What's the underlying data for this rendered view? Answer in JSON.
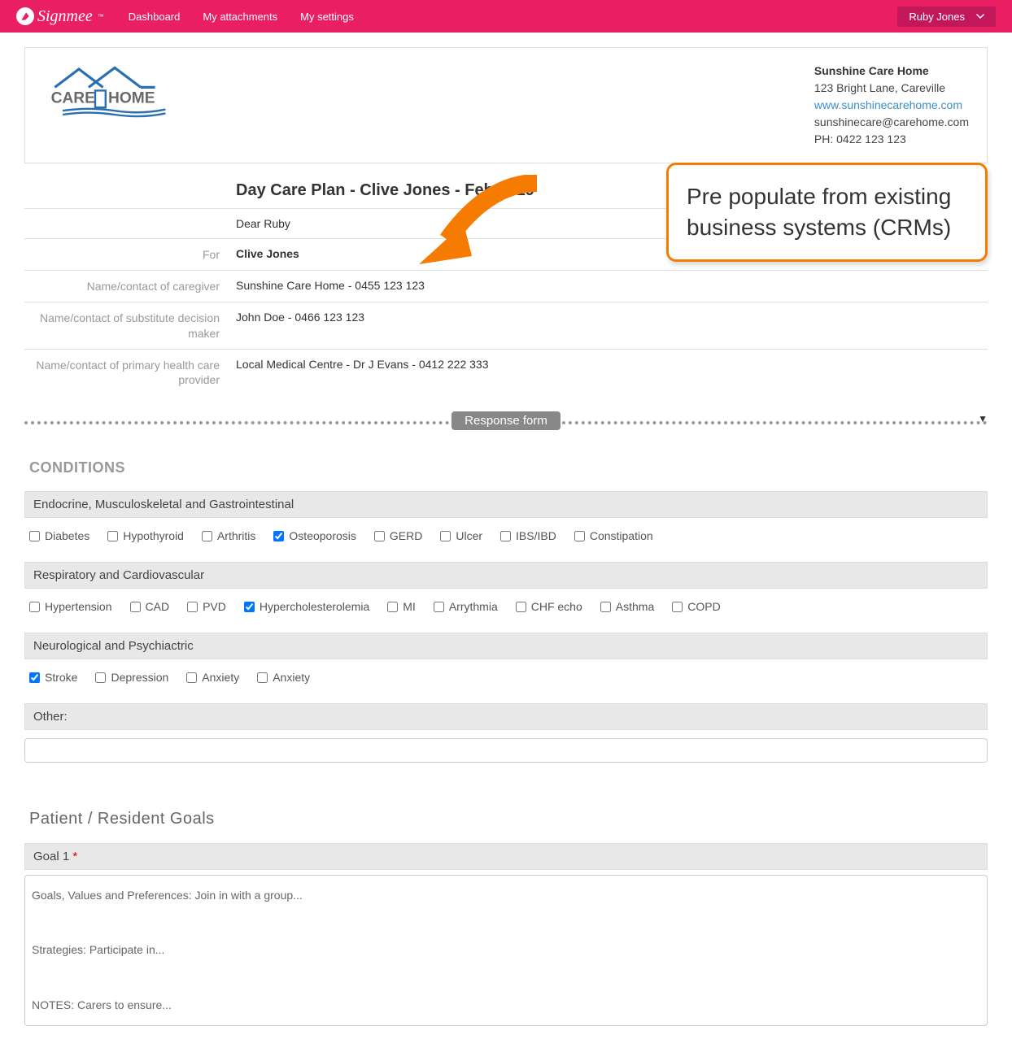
{
  "header": {
    "brand": "Signmee",
    "tm": "™",
    "nav": {
      "dashboard": "Dashboard",
      "attachments": "My attachments",
      "settings": "My settings"
    },
    "user": "Ruby Jones"
  },
  "org": {
    "logo_alt": "CARE HOME",
    "name": "Sunshine Care Home",
    "address": "123 Bright Lane, Careville",
    "website": "www.sunshinecarehome.com",
    "email": "sunshinecare@carehome.com",
    "phone": "PH: 0422 123 123"
  },
  "doc": {
    "title": "Day Care Plan - Clive Jones - Feb 2019",
    "greeting": "Dear Ruby",
    "rows": {
      "for_label": "For",
      "for_value": "Clive Jones",
      "caregiver_label": "Name/contact of caregiver",
      "caregiver_value": "Sunshine Care Home - 0455 123 123",
      "sub_label": "Name/contact of substitute decision maker",
      "sub_value": "John Doe - 0466 123 123",
      "primary_label": "Name/contact of primary health care provider",
      "primary_value": "Local Medical Centre - Dr J Evans - 0412 222 333"
    }
  },
  "divider": {
    "label": "Response form"
  },
  "conditions": {
    "heading": "CONDITIONS",
    "sections": [
      {
        "title": "Endocrine, Musculoskeletal and Gastrointestinal",
        "items": [
          {
            "label": "Diabetes",
            "checked": false
          },
          {
            "label": "Hypothyroid",
            "checked": false
          },
          {
            "label": "Arthritis",
            "checked": false
          },
          {
            "label": "Osteoporosis",
            "checked": true
          },
          {
            "label": "GERD",
            "checked": false
          },
          {
            "label": "Ulcer",
            "checked": false
          },
          {
            "label": "IBS/IBD",
            "checked": false
          },
          {
            "label": "Constipation",
            "checked": false
          }
        ]
      },
      {
        "title": "Respiratory and Cardiovascular",
        "items": [
          {
            "label": "Hypertension",
            "checked": false
          },
          {
            "label": "CAD",
            "checked": false
          },
          {
            "label": "PVD",
            "checked": false
          },
          {
            "label": "Hypercholesterolemia",
            "checked": true
          },
          {
            "label": "MI",
            "checked": false
          },
          {
            "label": "Arrythmia",
            "checked": false
          },
          {
            "label": "CHF echo",
            "checked": false
          },
          {
            "label": "Asthma",
            "checked": false
          },
          {
            "label": "COPD",
            "checked": false
          }
        ]
      },
      {
        "title": "Neurological and Psychiactric",
        "items": [
          {
            "label": "Stroke",
            "checked": true
          },
          {
            "label": "Depression",
            "checked": false
          },
          {
            "label": "Anxiety",
            "checked": false
          },
          {
            "label": "Anxiety",
            "checked": false
          }
        ]
      }
    ],
    "other_label": "Other:"
  },
  "goals": {
    "heading": "Patient / Resident Goals",
    "goal1_label": "Goal 1",
    "req": "*",
    "goal1_text": "Goals, Values and Preferences: Join in with a group...\n\nStrategies: Participate in...\n\nNOTES: Carers to ensure..."
  },
  "callout": {
    "text": "Pre populate from existing business systems (CRMs)"
  }
}
